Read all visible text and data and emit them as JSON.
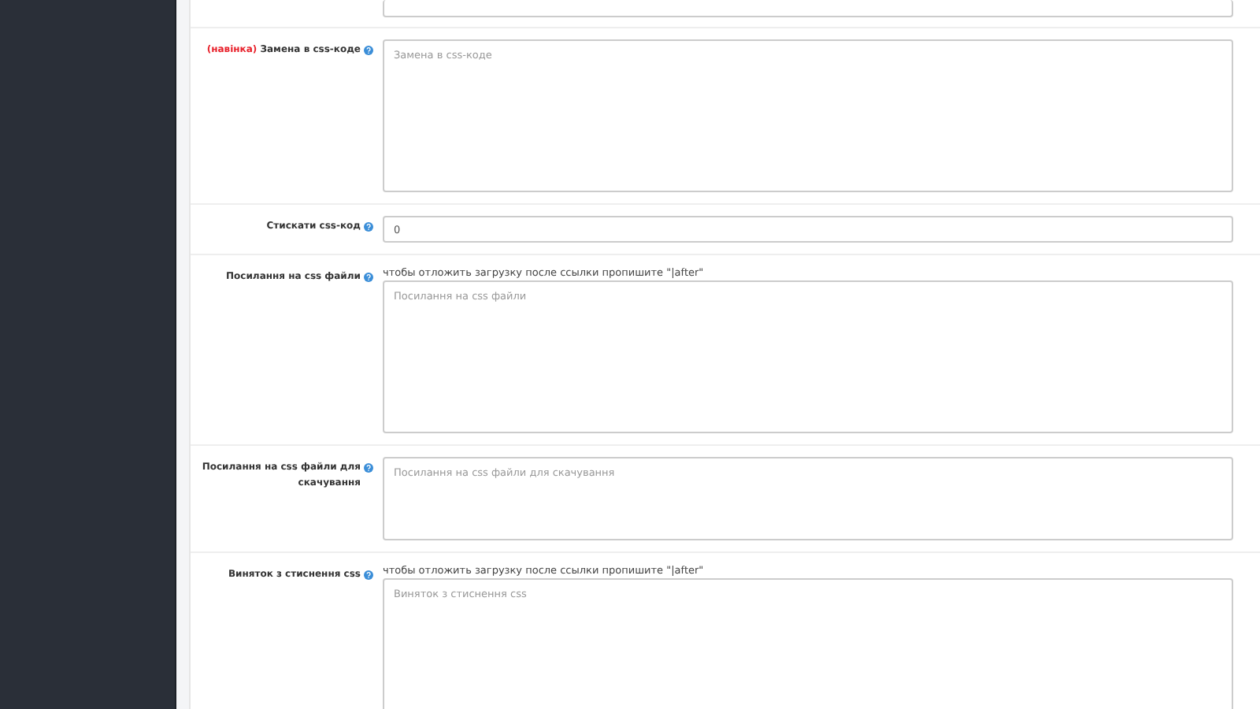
{
  "settings_rows": [
    {
      "kind": "cutinput"
    },
    {
      "kind": "textarea",
      "tag": "(навінка)",
      "label": "Замена в css-коде",
      "placeholder": "Замена в css-коде"
    },
    {
      "kind": "input",
      "label": "Стискати css-код",
      "value": "0"
    },
    {
      "kind": "textarea",
      "label": "Посилання на css файли",
      "hint": "чтобы отложить загрузку после ссылки пропишите \"|after\"",
      "placeholder": "Посилання на css файли"
    },
    {
      "kind": "smallarea",
      "label": "Посилання на css файли для скачування",
      "placeholder": "Посилання на css файли для скачування"
    },
    {
      "kind": "textarea",
      "label": "Виняток з стиснення css",
      "hint": "чтобы отложить загрузку после ссылки пропишите \"|after\"",
      "placeholder": "Виняток з стиснення css"
    }
  ]
}
